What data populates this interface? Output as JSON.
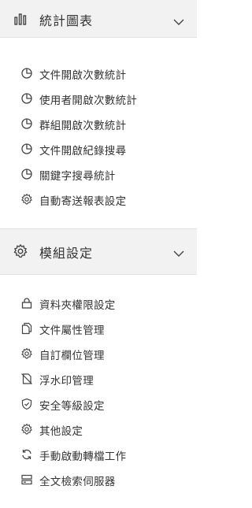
{
  "sections": [
    {
      "title": "統計圖表",
      "icon": "bar-chart-icon",
      "items": [
        {
          "label": "文件開啟次數統計",
          "icon": "pie-chart-icon"
        },
        {
          "label": "使用者開啟次數統計",
          "icon": "pie-chart-icon"
        },
        {
          "label": "群組開啟次數統計",
          "icon": "pie-chart-icon"
        },
        {
          "label": "文件開啟紀錄搜尋",
          "icon": "pie-chart-icon"
        },
        {
          "label": "關鍵字搜尋統計",
          "icon": "pie-chart-icon"
        },
        {
          "label": "自動寄送報表設定",
          "icon": "gear-icon"
        }
      ]
    },
    {
      "title": "模組設定",
      "icon": "gear-icon",
      "items": [
        {
          "label": "資料夾權限設定",
          "icon": "lock-icon"
        },
        {
          "label": "文件屬性管理",
          "icon": "documents-icon"
        },
        {
          "label": "自訂欄位管理",
          "icon": "gear-icon"
        },
        {
          "label": "浮水印管理",
          "icon": "watermark-off-icon"
        },
        {
          "label": "安全等級設定",
          "icon": "shield-icon"
        },
        {
          "label": "其他設定",
          "icon": "gear-icon"
        },
        {
          "label": "手動啟動轉檔工作",
          "icon": "refresh-icon"
        },
        {
          "label": "全文檢索伺服器",
          "icon": "server-icon"
        }
      ]
    }
  ],
  "colors": {
    "header_bg": "#f2f2f2",
    "text": "#333333",
    "icon": "#444444"
  }
}
